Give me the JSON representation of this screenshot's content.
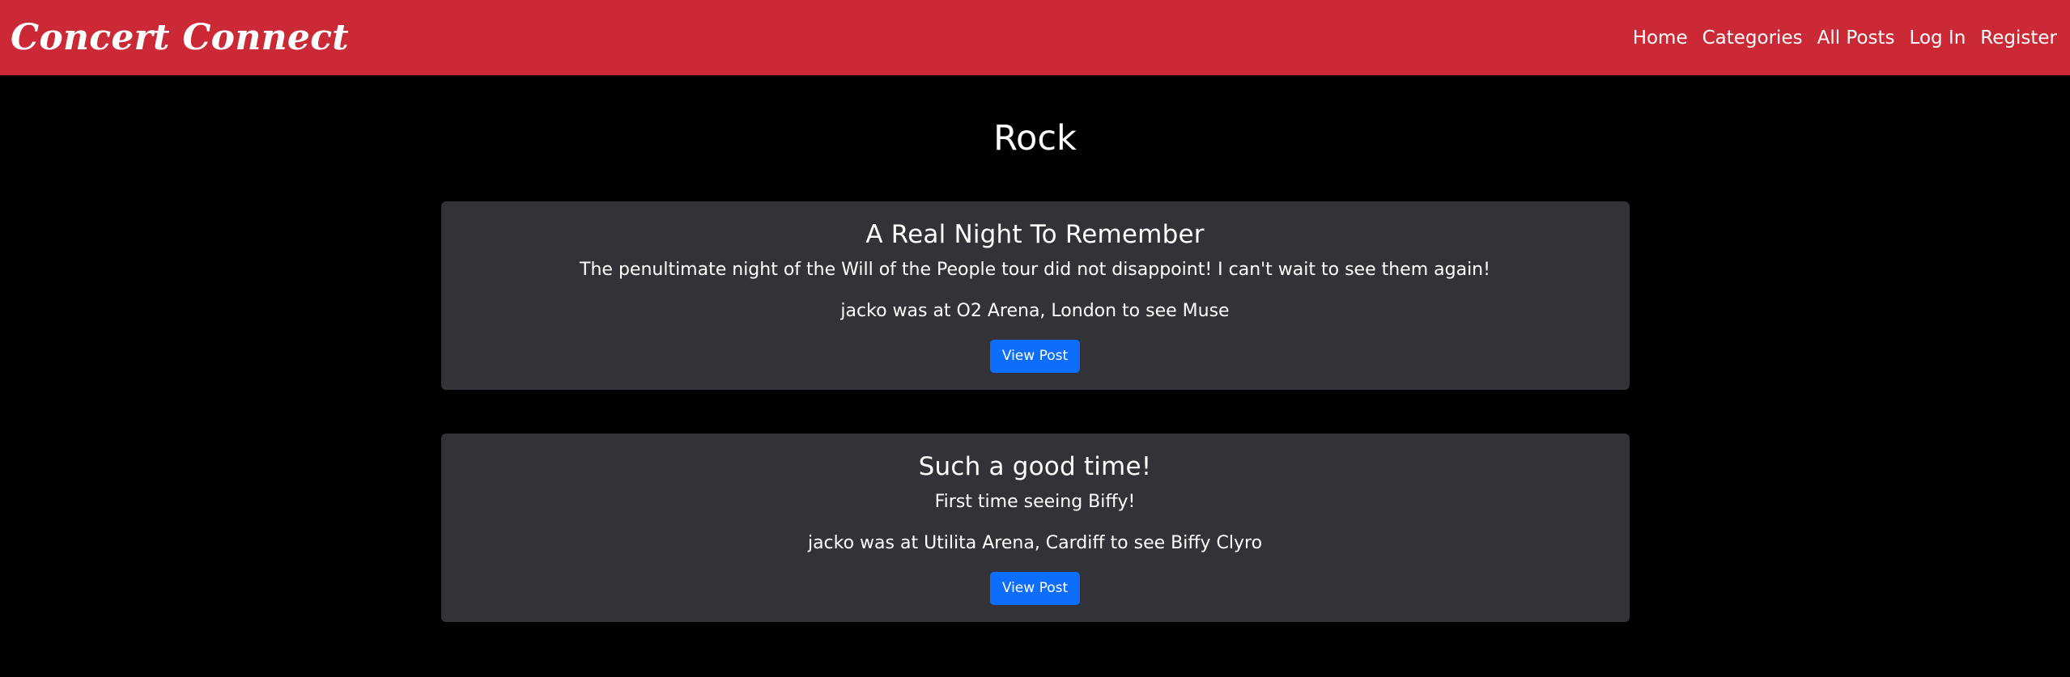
{
  "nav": {
    "brand": "Concert Connect",
    "links": [
      "Home",
      "Categories",
      "All Posts",
      "Log In",
      "Register"
    ]
  },
  "page": {
    "title": "Rock"
  },
  "posts": [
    {
      "title": "A Real Night To Remember",
      "body": "The penultimate night of the Will of the People tour did not disappoint! I can't wait to see them again!",
      "meta": "jacko was at O2 Arena, London to see Muse",
      "button": "View Post"
    },
    {
      "title": "Such a good time!",
      "body": "First time seeing Biffy!",
      "meta": "jacko was at Utilita Arena, Cardiff to see Biffy Clyro",
      "button": "View Post"
    }
  ],
  "colors": {
    "navbar": "#cc2936",
    "background": "#000000",
    "card": "#323238",
    "button": "#0d6efd"
  }
}
